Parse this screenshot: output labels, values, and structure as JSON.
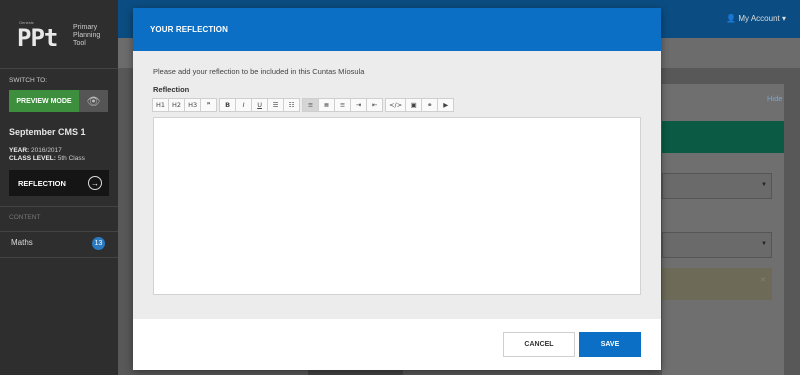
{
  "sidebar": {
    "logo_small": "Genesis",
    "logo_mark": "PPt",
    "logo_text": "Primary Planning Tool",
    "switch_to_label": "SWITCH TO:",
    "preview_mode_label": "PREVIEW MODE",
    "cms_title": "September CMS 1",
    "year_label": "YEAR:",
    "year_value": "2016/2017",
    "class_label": "CLASS LEVEL:",
    "class_value": "5th Class",
    "reflection_label": "REFLECTION",
    "content_label": "CONTENT",
    "maths_label": "Maths",
    "maths_count": "13"
  },
  "topbar": {
    "account_label": "My Account"
  },
  "main": {
    "hide_label": "Hide"
  },
  "modal": {
    "title": "YOUR REFLECTION",
    "instruction": "Please add your reflection to be included in this Cuntas Míosula",
    "field_label": "Reflection",
    "toolbar": {
      "h1": "H1",
      "h2": "H2",
      "h3": "H3",
      "quote": "❞",
      "bold": "B",
      "italic": "I",
      "underline": "U",
      "ul": "☰",
      "ol": "☷",
      "align_left": "≡",
      "align_center": "≣",
      "align_right": "≡",
      "indent": "⇥",
      "outdent": "⇤",
      "code": "</>",
      "image": "▣",
      "link": "⚭",
      "video": "▶"
    },
    "editor_value": "",
    "cancel_label": "CANCEL",
    "save_label": "SAVE"
  },
  "colors": {
    "modal_header": "#0a6fc5",
    "save_button": "#0a6fc5",
    "preview_button": "#3d8f3d",
    "topbar": "#0b4d82",
    "badge": "#2a7ac2"
  }
}
